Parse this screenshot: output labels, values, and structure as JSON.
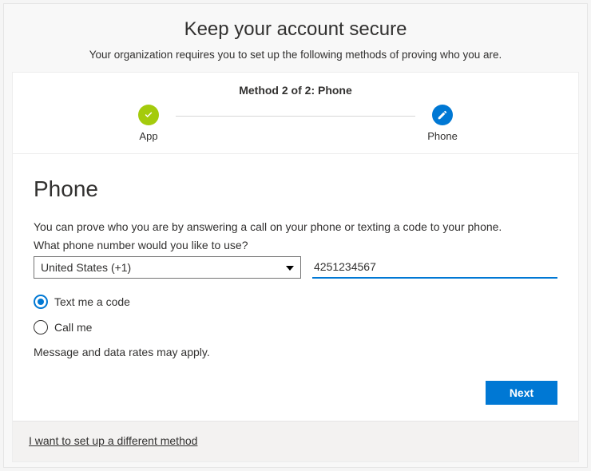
{
  "header": {
    "title": "Keep your account secure",
    "subtitle": "Your organization requires you to set up the following methods of proving who you are."
  },
  "stepper": {
    "title": "Method 2 of 2: Phone",
    "steps": [
      {
        "label": "App"
      },
      {
        "label": "Phone"
      }
    ]
  },
  "phone": {
    "heading": "Phone",
    "helper": "You can prove who you are by answering a call on your phone or texting a code to your phone.",
    "prompt": "What phone number would you like to use?",
    "country_selected": "United States (+1)",
    "number_value": "4251234567",
    "options": {
      "text": "Text me a code",
      "call": "Call me"
    },
    "rates": "Message and data rates may apply."
  },
  "actions": {
    "next": "Next"
  },
  "footer": {
    "alt_method": "I want to set up a different method"
  }
}
